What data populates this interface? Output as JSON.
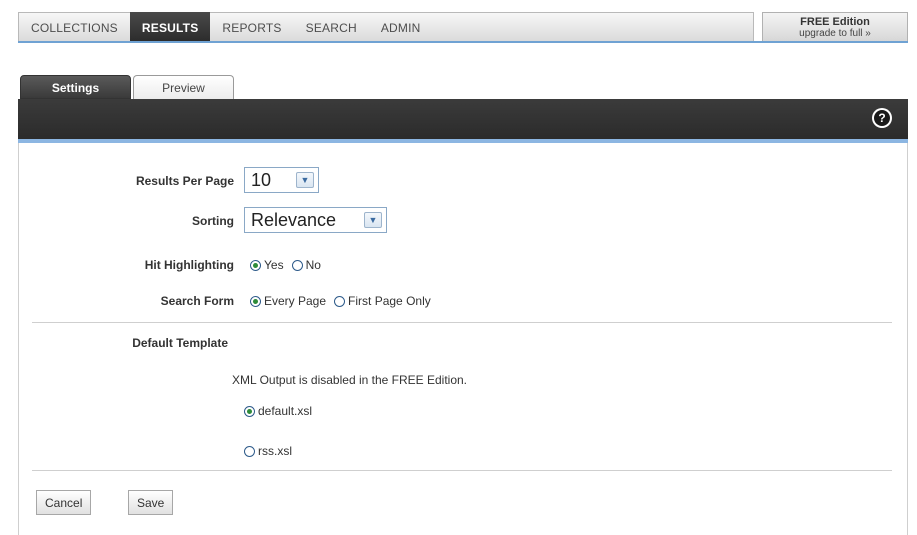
{
  "nav": {
    "items": [
      "COLLECTIONS",
      "RESULTS",
      "REPORTS",
      "SEARCH",
      "ADMIN"
    ],
    "active": "RESULTS"
  },
  "edition": {
    "title": "FREE Edition",
    "upgrade_link": "upgrade to full »"
  },
  "tabs": {
    "settings": "Settings",
    "preview": "Preview"
  },
  "help_icon": "?",
  "form": {
    "results_per_page": {
      "label": "Results Per Page",
      "value": "10"
    },
    "sorting": {
      "label": "Sorting",
      "value": "Relevance"
    },
    "hit_highlighting": {
      "label": "Hit Highlighting",
      "options": [
        "Yes",
        "No"
      ],
      "selected": "Yes"
    },
    "search_form": {
      "label": "Search Form",
      "options": [
        "Every Page",
        "First Page Only"
      ],
      "selected": "Every Page"
    },
    "default_template": {
      "label": "Default Template",
      "note": "XML Output is disabled in the FREE Edition.",
      "options": [
        "default.xsl",
        "rss.xsl"
      ],
      "selected": "default.xsl"
    }
  },
  "buttons": {
    "cancel": "Cancel",
    "save": "Save"
  },
  "colors": {
    "active_tab": "#3a3a3a",
    "accent_blue": "#6fa2d3",
    "radio_selected": "#2e8b3a"
  }
}
